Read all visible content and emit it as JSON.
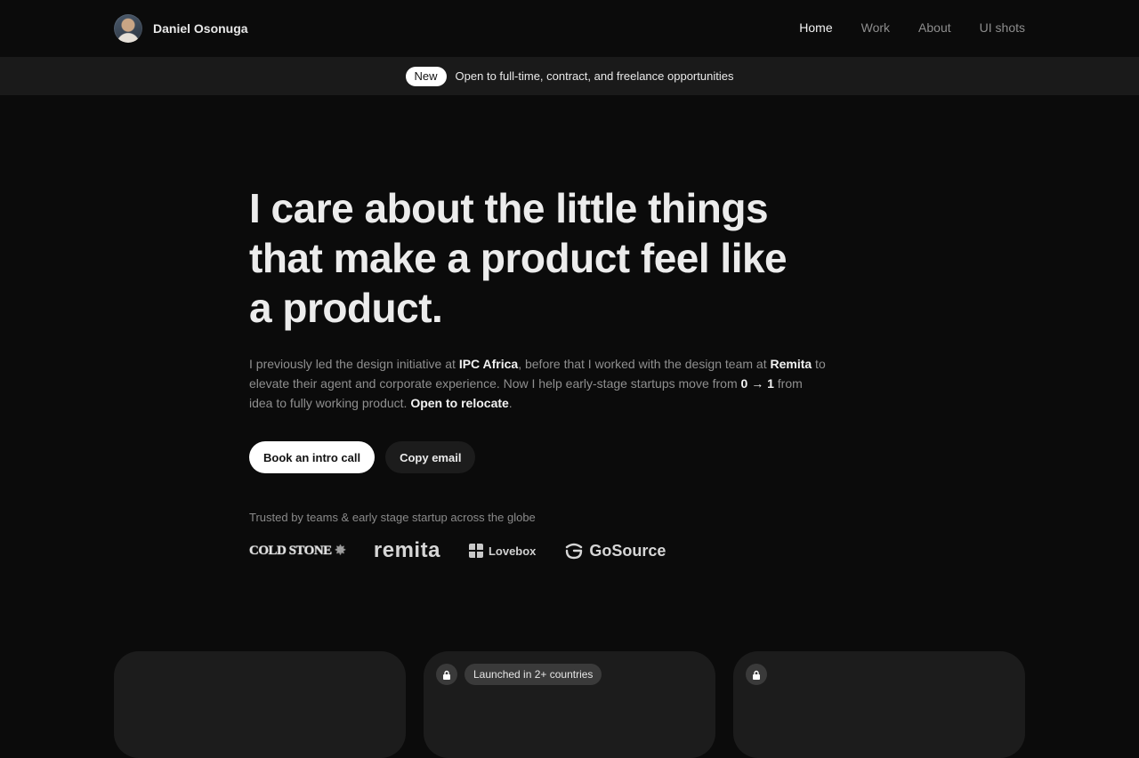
{
  "header": {
    "name": "Daniel Osonuga",
    "nav": [
      {
        "label": "Home",
        "active": true
      },
      {
        "label": "Work",
        "active": false
      },
      {
        "label": "About",
        "active": false
      },
      {
        "label": "UI shots",
        "active": false
      }
    ]
  },
  "banner": {
    "badge": "New",
    "text": "Open to full-time, contract, and freelance opportunities"
  },
  "hero": {
    "headline": "I care about the little things that make a product feel like a product.",
    "intro": {
      "p1": "I previously led the design initiative at ",
      "company1": "IPC Africa",
      "p2": ", before that I worked with the design team at ",
      "company2": "Remita",
      "p3": " to elevate their agent and corporate experience. Now I help early-stage startups move from ",
      "range": "0 → 1",
      "p4": " from idea to fully working product. ",
      "relocate": "Open to relocate",
      "p5": "."
    },
    "primary_cta": "Book an intro call",
    "secondary_cta": "Copy email",
    "trusted_label": "Trusted by teams & early stage startup across the globe",
    "logos": {
      "coldstone": "COLD STONE",
      "remita": "remita",
      "lovebox": "Lovebox",
      "gosource": "GoSource"
    }
  },
  "cards": [
    {
      "locked": false,
      "badge": ""
    },
    {
      "locked": true,
      "badge": "Launched in 2+ countries"
    },
    {
      "locked": true,
      "badge": ""
    }
  ],
  "colors": {
    "background": "#0b0b0b",
    "banner": "#1a1a1a",
    "card": "#1c1c1c",
    "text_primary": "#ececec",
    "text_muted": "#8f8f8f"
  }
}
